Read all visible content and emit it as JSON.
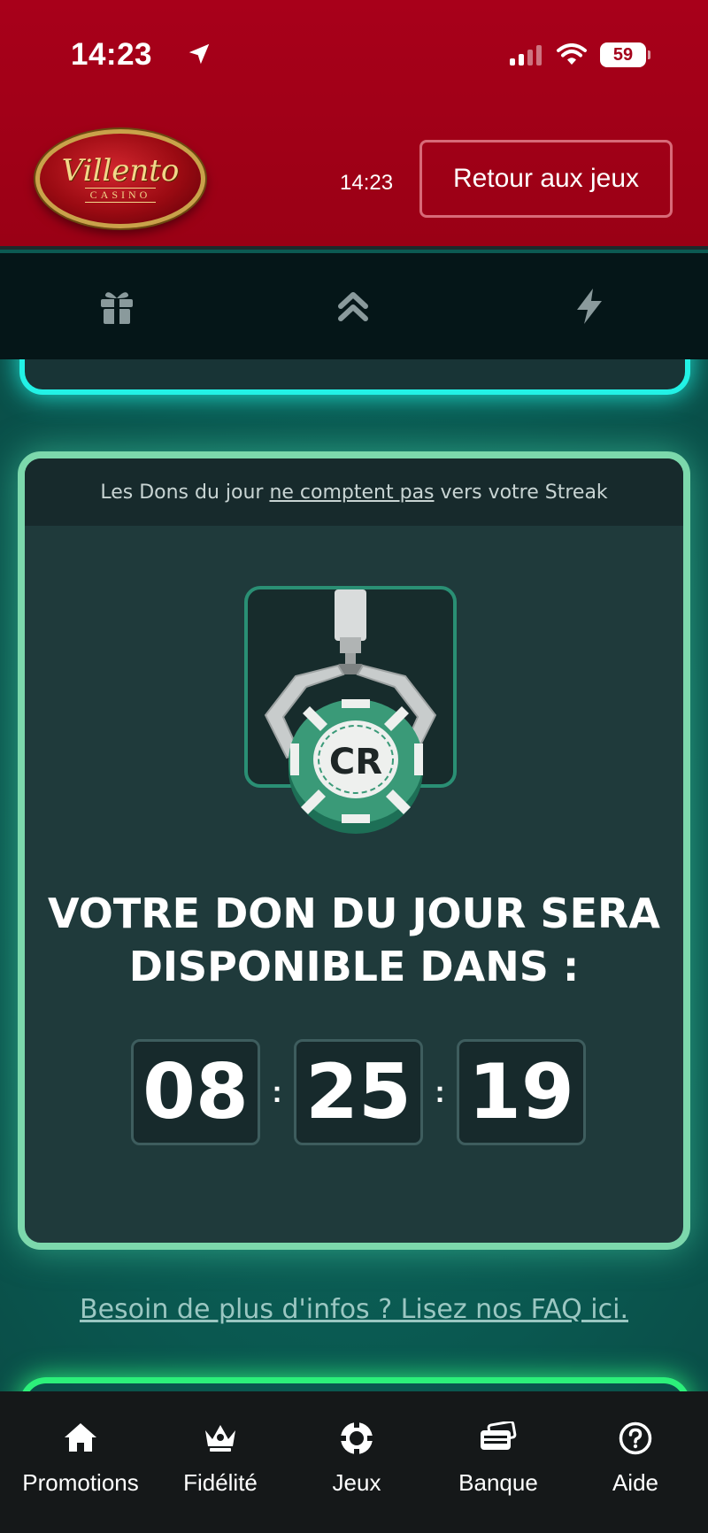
{
  "status_bar": {
    "time": "14:23",
    "battery": "59"
  },
  "header": {
    "logo_script": "Villento",
    "logo_sub": "CASINO",
    "clock": "14:23",
    "return_button": "Retour aux jeux"
  },
  "tab_icons": [
    "gift-icon",
    "chevrons-up-icon",
    "lightning-icon"
  ],
  "card": {
    "note_before": "Les Dons du jour ",
    "note_link": "ne comptent pas",
    "note_after": " vers votre Streak",
    "chip_text": "CR",
    "title_line1": "VOTRE DON DU JOUR SERA",
    "title_line2": "DISPONIBLE DANS :",
    "timer": {
      "hours": "08",
      "minutes": "25",
      "seconds": "19",
      "separator": ":"
    }
  },
  "faq_link": "Besoin de plus d'infos ? Lisez nos FAQ ici.",
  "bottom_nav": [
    {
      "label": "Promotions",
      "icon": "home-icon"
    },
    {
      "label": "Fidélité",
      "icon": "crown-icon"
    },
    {
      "label": "Jeux",
      "icon": "chip-icon"
    },
    {
      "label": "Banque",
      "icon": "wallet-icon"
    },
    {
      "label": "Aide",
      "icon": "help-icon"
    }
  ],
  "colors": {
    "header_red": "#a8001a",
    "card_border": "#7cd8ac",
    "prev_card_glow": "#22f2e6",
    "next_card_glow": "#2cf07a",
    "nav_bg": "#151819"
  }
}
